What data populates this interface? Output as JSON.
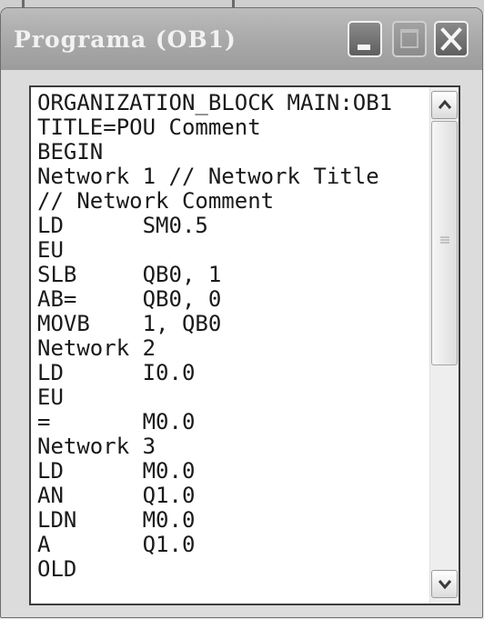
{
  "window": {
    "title": "Programa (OB1)",
    "buttons": {
      "minimize": "minimize",
      "maximize": "maximize",
      "close": "close"
    }
  },
  "editor": {
    "lines": [
      "ORGANIZATION_BLOCK MAIN:OB1",
      "TITLE=POU Comment",
      "BEGIN",
      "Network 1 // Network Title",
      "// Network Comment",
      "LD      SM0.5",
      "EU",
      "SLB     QB0, 1",
      "AB=     QB0, 0",
      "MOVB    1, QB0",
      "Network 2",
      "LD      I0.0",
      "EU",
      "=       M0.0",
      "Network 3",
      "LD      M0.0",
      "AN      Q1.0",
      "LDN     M0.0",
      "A       Q1.0",
      "OLD"
    ],
    "scroll_position": 0.0
  },
  "icons": {
    "minimize": "minimize-icon",
    "maximize": "maximize-icon",
    "close": "close-icon",
    "scroll_up": "chevron-up-icon",
    "scroll_down": "chevron-down-icon",
    "grip": "scroll-grip-icon"
  },
  "colors": {
    "titlebar": "#a8a8a8",
    "title_text": "#f2f2f2",
    "editor_bg": "#ffffff",
    "code_text": "#1a1a1a"
  }
}
